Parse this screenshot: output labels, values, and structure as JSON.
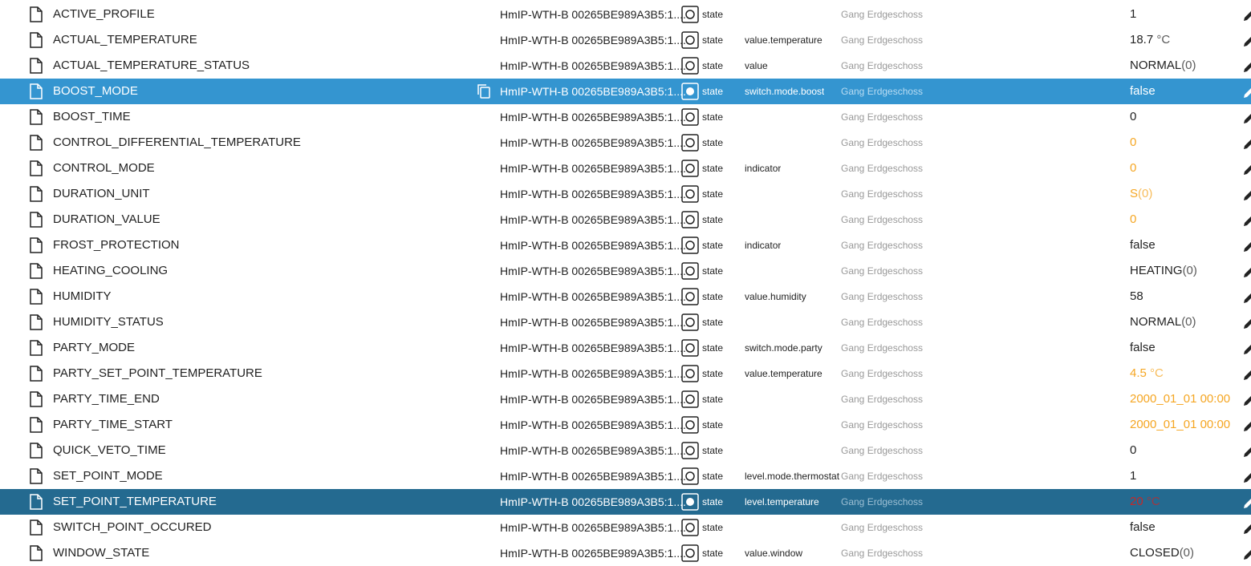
{
  "colors": {
    "selected_row": "#3495d0",
    "selected_row_dark": "#246a90",
    "orange_value": "#f5a623",
    "red_value": "#c62828",
    "room_text": "#999999"
  },
  "icons": {
    "object": "file-icon",
    "state": "state-circle-icon",
    "copy": "copy-icon",
    "edit": "pencil-icon"
  },
  "rows": [
    {
      "name": "ACTIVE_PROFILE",
      "device": "HmIP-WTH-B 00265BE989A3B5:1....",
      "type": "state",
      "role": "",
      "room": "Gang Erdgeschoss",
      "value": "1",
      "unit": "",
      "color": "normal",
      "selected": ""
    },
    {
      "name": "ACTUAL_TEMPERATURE",
      "device": "HmIP-WTH-B 00265BE989A3B5:1....",
      "type": "state",
      "role": "value.temperature",
      "room": "Gang Erdgeschoss",
      "value": "18.7",
      "unit": "°C",
      "color": "normal",
      "selected": ""
    },
    {
      "name": "ACTUAL_TEMPERATURE_STATUS",
      "device": "HmIP-WTH-B 00265BE989A3B5:1....",
      "type": "state",
      "role": "value",
      "room": "Gang Erdgeschoss",
      "value": "NORMAL",
      "unit": "(0)",
      "color": "normal",
      "selected": ""
    },
    {
      "name": "BOOST_MODE",
      "device": "HmIP-WTH-B 00265BE989A3B5:1....",
      "type": "state",
      "role": "switch.mode.boost",
      "room": "Gang Erdgeschoss",
      "value": "false",
      "unit": "",
      "color": "normal",
      "selected": "light"
    },
    {
      "name": "BOOST_TIME",
      "device": "HmIP-WTH-B 00265BE989A3B5:1....",
      "type": "state",
      "role": "",
      "room": "Gang Erdgeschoss",
      "value": "0",
      "unit": "",
      "color": "normal",
      "selected": ""
    },
    {
      "name": "CONTROL_DIFFERENTIAL_TEMPERATURE",
      "device": "HmIP-WTH-B 00265BE989A3B5:1....",
      "type": "state",
      "role": "",
      "room": "Gang Erdgeschoss",
      "value": "0",
      "unit": "",
      "color": "orange",
      "selected": ""
    },
    {
      "name": "CONTROL_MODE",
      "device": "HmIP-WTH-B 00265BE989A3B5:1....",
      "type": "state",
      "role": "indicator",
      "room": "Gang Erdgeschoss",
      "value": "0",
      "unit": "",
      "color": "orange",
      "selected": ""
    },
    {
      "name": "DURATION_UNIT",
      "device": "HmIP-WTH-B 00265BE989A3B5:1....",
      "type": "state",
      "role": "",
      "room": "Gang Erdgeschoss",
      "value": "S",
      "unit": "(0)",
      "color": "orange",
      "selected": ""
    },
    {
      "name": "DURATION_VALUE",
      "device": "HmIP-WTH-B 00265BE989A3B5:1....",
      "type": "state",
      "role": "",
      "room": "Gang Erdgeschoss",
      "value": "0",
      "unit": "",
      "color": "orange",
      "selected": ""
    },
    {
      "name": "FROST_PROTECTION",
      "device": "HmIP-WTH-B 00265BE989A3B5:1....",
      "type": "state",
      "role": "indicator",
      "room": "Gang Erdgeschoss",
      "value": "false",
      "unit": "",
      "color": "normal",
      "selected": ""
    },
    {
      "name": "HEATING_COOLING",
      "device": "HmIP-WTH-B 00265BE989A3B5:1....",
      "type": "state",
      "role": "",
      "room": "Gang Erdgeschoss",
      "value": "HEATING",
      "unit": "(0)",
      "color": "normal",
      "selected": ""
    },
    {
      "name": "HUMIDITY",
      "device": "HmIP-WTH-B 00265BE989A3B5:1....",
      "type": "state",
      "role": "value.humidity",
      "room": "Gang Erdgeschoss",
      "value": "58",
      "unit": "",
      "color": "normal",
      "selected": ""
    },
    {
      "name": "HUMIDITY_STATUS",
      "device": "HmIP-WTH-B 00265BE989A3B5:1....",
      "type": "state",
      "role": "",
      "room": "Gang Erdgeschoss",
      "value": "NORMAL",
      "unit": "(0)",
      "color": "normal",
      "selected": ""
    },
    {
      "name": "PARTY_MODE",
      "device": "HmIP-WTH-B 00265BE989A3B5:1....",
      "type": "state",
      "role": "switch.mode.party",
      "room": "Gang Erdgeschoss",
      "value": "false",
      "unit": "",
      "color": "normal",
      "selected": ""
    },
    {
      "name": "PARTY_SET_POINT_TEMPERATURE",
      "device": "HmIP-WTH-B 00265BE989A3B5:1....",
      "type": "state",
      "role": "value.temperature",
      "room": "Gang Erdgeschoss",
      "value": "4.5",
      "unit": "°C",
      "color": "orange",
      "selected": ""
    },
    {
      "name": "PARTY_TIME_END",
      "device": "HmIP-WTH-B 00265BE989A3B5:1....",
      "type": "state",
      "role": "",
      "room": "Gang Erdgeschoss",
      "value": "2000_01_01 00:00",
      "unit": "",
      "color": "orange",
      "selected": ""
    },
    {
      "name": "PARTY_TIME_START",
      "device": "HmIP-WTH-B 00265BE989A3B5:1....",
      "type": "state",
      "role": "",
      "room": "Gang Erdgeschoss",
      "value": "2000_01_01 00:00",
      "unit": "",
      "color": "orange",
      "selected": ""
    },
    {
      "name": "QUICK_VETO_TIME",
      "device": "HmIP-WTH-B 00265BE989A3B5:1....",
      "type": "state",
      "role": "",
      "room": "Gang Erdgeschoss",
      "value": "0",
      "unit": "",
      "color": "normal",
      "selected": ""
    },
    {
      "name": "SET_POINT_MODE",
      "device": "HmIP-WTH-B 00265BE989A3B5:1....",
      "type": "state",
      "role": "level.mode.thermostat",
      "room": "Gang Erdgeschoss",
      "value": "1",
      "unit": "",
      "color": "normal",
      "selected": ""
    },
    {
      "name": "SET_POINT_TEMPERATURE",
      "device": "HmIP-WTH-B 00265BE989A3B5:1....",
      "type": "state",
      "role": "level.temperature",
      "room": "Gang Erdgeschoss",
      "value": "20",
      "unit": "°C",
      "color": "red",
      "selected": "dark"
    },
    {
      "name": "SWITCH_POINT_OCCURED",
      "device": "HmIP-WTH-B 00265BE989A3B5:1....",
      "type": "state",
      "role": "",
      "room": "Gang Erdgeschoss",
      "value": "false",
      "unit": "",
      "color": "normal",
      "selected": ""
    },
    {
      "name": "WINDOW_STATE",
      "device": "HmIP-WTH-B 00265BE989A3B5:1....",
      "type": "state",
      "role": "value.window",
      "room": "Gang Erdgeschoss",
      "value": "CLOSED",
      "unit": "(0)",
      "color": "normal",
      "selected": ""
    }
  ]
}
